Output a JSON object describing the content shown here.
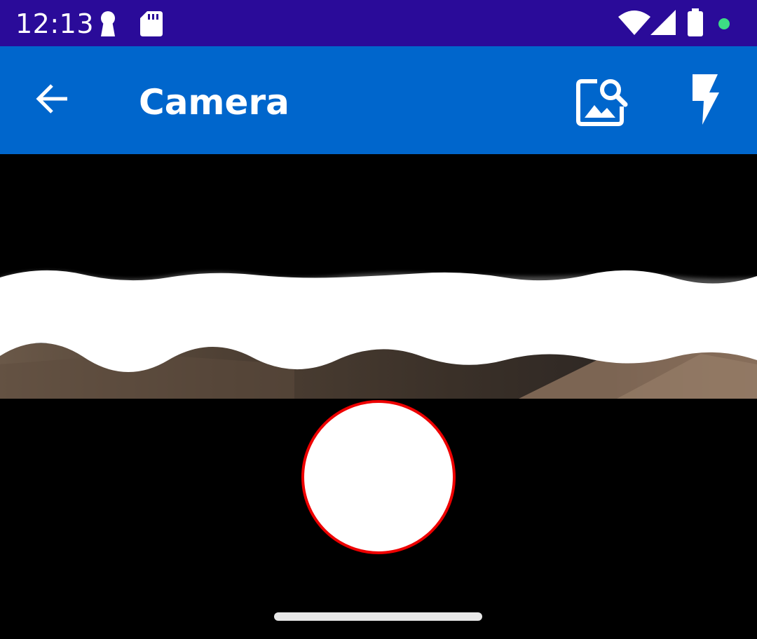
{
  "status_bar": {
    "time": "12:13",
    "icons": [
      "keyhole-icon",
      "sd-card-icon",
      "wifi-icon",
      "signal-icon",
      "battery-icon",
      "dot-icon"
    ],
    "background": "#2a0b99",
    "dot_color": "#3ddc84"
  },
  "app_bar": {
    "title": "Camera",
    "background": "#0066cc",
    "icons": [
      "back-arrow-icon",
      "image-search-icon",
      "flash-icon"
    ]
  },
  "preview": {
    "description_icons": [
      "torn-paper-edge"
    ]
  },
  "shutter": {
    "fill": "#ffffff",
    "border": "#ee0000"
  }
}
